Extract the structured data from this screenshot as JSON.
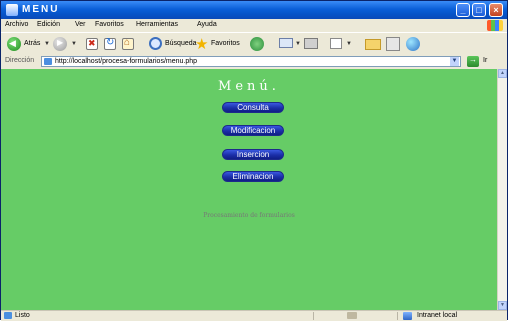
{
  "window": {
    "title": "MENU"
  },
  "menubar": {
    "items": [
      "Archivo",
      "Edición",
      "Ver",
      "Favoritos",
      "Herramientas",
      "Ayuda"
    ]
  },
  "toolbar": {
    "back_label": "Atrás",
    "search_label": "Búsqueda",
    "favorites_label": "Favoritos"
  },
  "address": {
    "label": "Dirección",
    "url": "http://localhost/procesa-formularios/menu.php",
    "go_label": "Ir"
  },
  "page": {
    "title": "Menú.",
    "buttons": [
      "Consulta",
      "Modificacion",
      "Insercion",
      "Eliminacion"
    ],
    "footer": "Procesamiento de formularios",
    "background_color": "#66cc66",
    "button_color": "#1b2fa8"
  },
  "status": {
    "text": "Listo",
    "zone": "Intranet local"
  }
}
